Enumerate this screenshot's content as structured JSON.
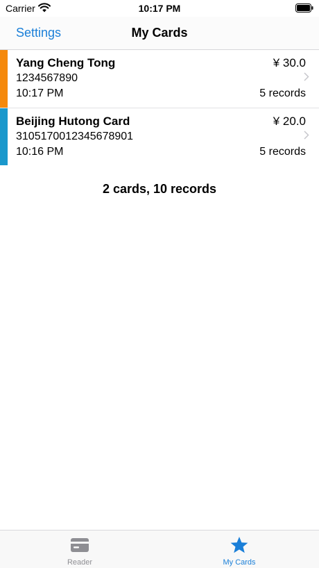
{
  "status_bar": {
    "carrier": "Carrier",
    "time": "10:17 PM"
  },
  "nav": {
    "back_label": "Settings",
    "title": "My Cards"
  },
  "cards": [
    {
      "name": "Yang Cheng Tong",
      "number": "1234567890",
      "time": "10:17 PM",
      "balance": "¥ 30.0",
      "records": "5 records",
      "color": "#f5890c"
    },
    {
      "name": "Beijing Hutong Card",
      "number": "3105170012345678901",
      "time": "10:16 PM",
      "balance": "¥ 20.0",
      "records": "5 records",
      "color": "#1a98cc"
    }
  ],
  "summary": "2 cards, 10 records",
  "tabs": [
    {
      "label": "Reader",
      "icon": "card-icon",
      "active": false
    },
    {
      "label": "My Cards",
      "icon": "star-icon",
      "active": true
    }
  ],
  "colors": {
    "accent": "#1a7fd8",
    "inactive": "#8e8e93"
  }
}
